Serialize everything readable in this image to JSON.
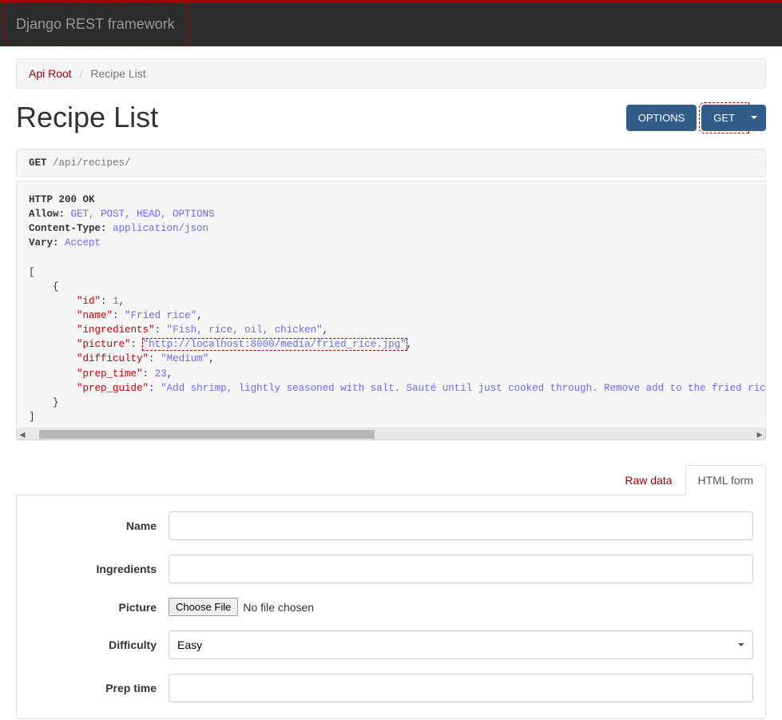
{
  "navbar": {
    "brand": "Django REST framework"
  },
  "breadcrumb": {
    "root": "Api Root",
    "current": "Recipe List"
  },
  "page": {
    "title": "Recipe List"
  },
  "buttons": {
    "options": "OPTIONS",
    "get": "GET"
  },
  "request": {
    "method": "GET",
    "path": " /api/recipes/"
  },
  "response": {
    "status": "HTTP 200 OK",
    "headers": {
      "allow_k": "Allow:",
      "allow_v": " GET, POST, HEAD, OPTIONS",
      "ctype_k": "Content-Type:",
      "ctype_v": " application/json",
      "vary_k": "Vary:",
      "vary_v": " Accept"
    },
    "body": {
      "id_k": "\"id\"",
      "id_v": "1",
      "name_k": "\"name\"",
      "name_v": "\"Fried rice\"",
      "ing_k": "\"ingredients\"",
      "ing_v": "\"Fish, rice, oil, chicken\"",
      "pic_k": "\"picture\"",
      "pic_v": "\"http://localhost:8000/media/fried_rice.jpg\"",
      "diff_k": "\"difficulty\"",
      "diff_v": "\"Medium\"",
      "prep_k": "\"prep_time\"",
      "prep_v": "23",
      "guide_k": "\"prep_guide\"",
      "guide_v": "\"Add shrimp, lightly seasoned with salt. Sauté until just cooked through. Remove add to the fried rice. Nex"
    }
  },
  "tabs": {
    "raw": "Raw data",
    "html": "HTML form"
  },
  "form": {
    "name_lbl": "Name",
    "ing_lbl": "Ingredients",
    "pic_lbl": "Picture",
    "diff_lbl": "Difficulty",
    "prep_lbl": "Prep time",
    "file_btn": "Choose File",
    "file_none": "No file chosen",
    "diff_selected": "Easy"
  }
}
